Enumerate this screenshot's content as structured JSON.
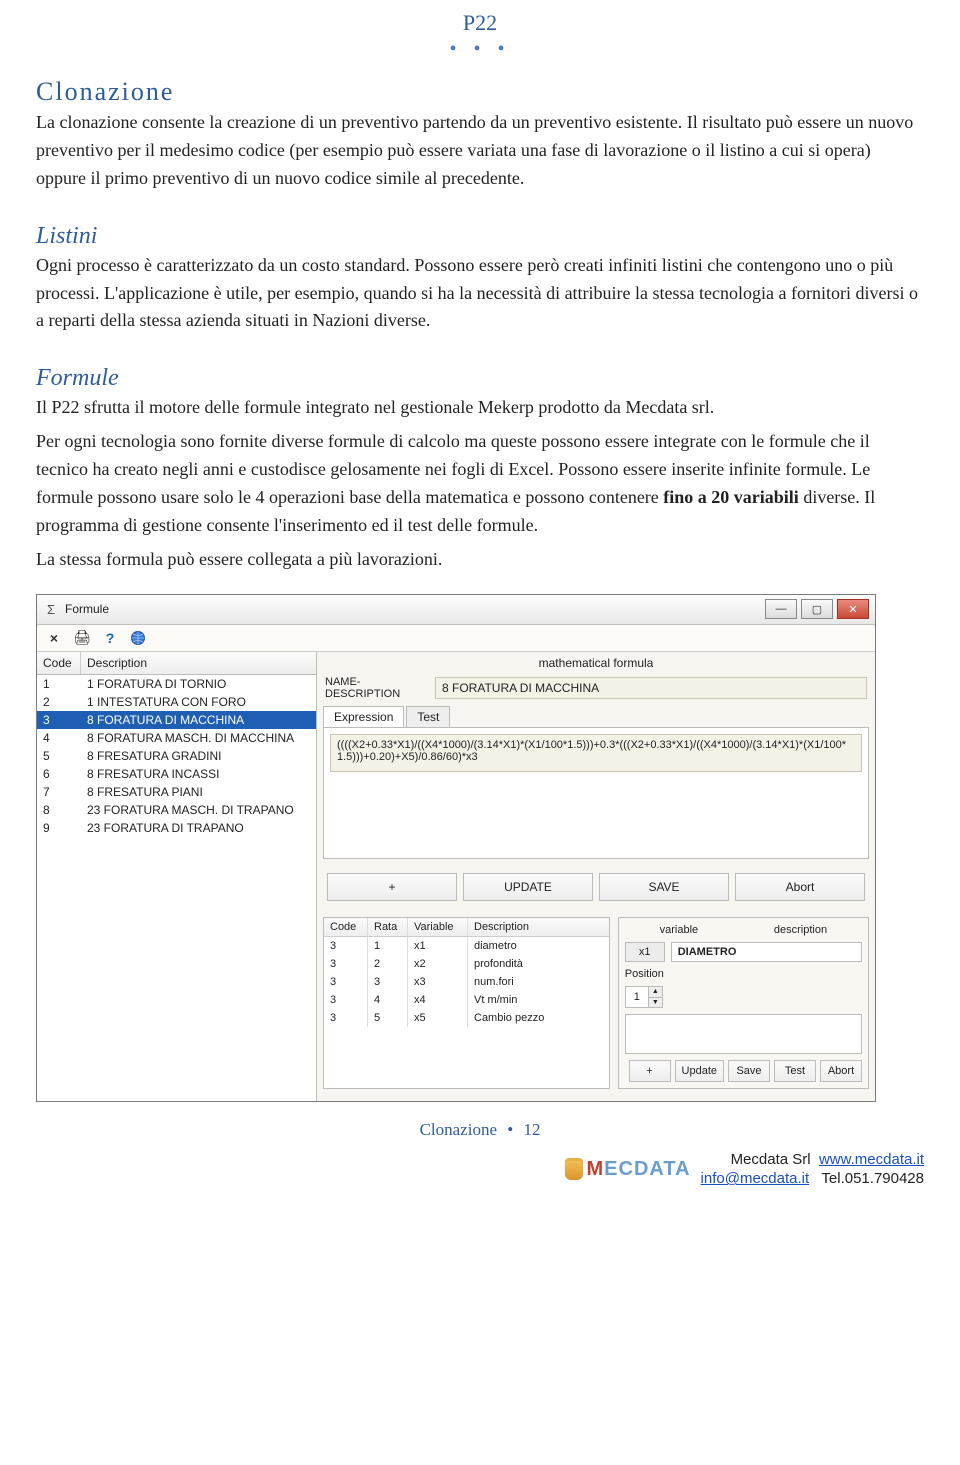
{
  "header": {
    "doc_code": "P22",
    "dots": "• • •"
  },
  "sections": {
    "clonazione": {
      "title": "Clonazione",
      "p1": "La clonazione consente la creazione di un preventivo partendo da un preventivo esistente. Il risultato può essere un nuovo preventivo per il medesimo codice (per esempio può essere variata una fase di lavorazione o il listino a cui si opera) oppure il primo preventivo di un nuovo codice simile al precedente."
    },
    "listini": {
      "title": "Listini",
      "p1": "Ogni processo è caratterizzato da un costo standard. Possono essere però creati infiniti listini che contengono uno o più processi. L'applicazione è utile, per esempio, quando si ha la necessità di attribuire la stessa tecnologia a fornitori diversi o a reparti della stessa azienda situati in Nazioni diverse."
    },
    "formule": {
      "title": "Formule",
      "p1": "Il P22 sfrutta il motore delle formule integrato nel gestionale Mekerp prodotto da  Mecdata srl.",
      "p2a": "Per ogni tecnologia sono fornite diverse formule di calcolo ma queste possono essere integrate con le formule che il tecnico ha creato negli anni e custodisce gelosamente nei fogli di Excel. Possono essere inserite infinite formule. Le formule possono usare solo le 4 operazioni base della matematica e possono contenere ",
      "p2_bold": "fino a 20 variabili",
      "p2b": " diverse. Il programma di gestione consente l'inserimento ed il test delle formule.",
      "p3": "La stessa formula può essere collegata a più lavorazioni."
    }
  },
  "app": {
    "window_title": "Formule",
    "toolbar": {
      "close": "×",
      "print": "🖨",
      "help": "?",
      "web": "🌐"
    },
    "list": {
      "col_code": "Code",
      "col_desc": "Description",
      "rows": [
        {
          "code": "1",
          "desc": "1 FORATURA DI TORNIO"
        },
        {
          "code": "2",
          "desc": "1 INTESTATURA CON FORO"
        },
        {
          "code": "3",
          "desc": "8 FORATURA DI MACCHINA",
          "selected": true
        },
        {
          "code": "4",
          "desc": "8 FORATURA MASCH. DI MACCHINA"
        },
        {
          "code": "5",
          "desc": "8 FRESATURA GRADINI"
        },
        {
          "code": "6",
          "desc": "8 FRESATURA INCASSI"
        },
        {
          "code": "7",
          "desc": "8 FRESATURA PIANI"
        },
        {
          "code": "8",
          "desc": "23 FORATURA MASCH. DI TRAPANO"
        },
        {
          "code": "9",
          "desc": "23 FORATURA DI TRAPANO"
        }
      ]
    },
    "right": {
      "math_label": "mathematical formula",
      "name_label": "NAME-DESCRIPTION",
      "name_value": "8 FORATURA DI MACCHINA",
      "tabs": {
        "expression": "Expression",
        "test": "Test"
      },
      "expression": "((((X2+0.33*X1)/((X4*1000)/(3.14*X1)*(X1/100*1.5)))+0.3*(((X2+0.33*X1)/((X4*1000)/(3.14*X1)*(X1/100*1.5)))+0.20)+X5)/0.86/60)*x3",
      "buttons": {
        "plus": "+",
        "update": "UPDATE",
        "save": "SAVE",
        "abort": "Abort"
      },
      "vars": {
        "head": {
          "code": "Code",
          "rata": "Rata",
          "variable": "Variable",
          "description": "Description"
        },
        "rows": [
          {
            "code": "3",
            "rata": "1",
            "var": "x1",
            "desc": "diametro"
          },
          {
            "code": "3",
            "rata": "2",
            "var": "x2",
            "desc": "profondità"
          },
          {
            "code": "3",
            "rata": "3",
            "var": "x3",
            "desc": "num.fori"
          },
          {
            "code": "3",
            "rata": "4",
            "var": "x4",
            "desc": "Vt m/min"
          },
          {
            "code": "3",
            "rata": "5",
            "var": "x5",
            "desc": "Cambio pezzo"
          }
        ]
      },
      "detail": {
        "lbl_variable": "variable",
        "lbl_description": "description",
        "var_value": "x1",
        "desc_value": "DIAMETRO",
        "lbl_position": "Position",
        "position_value": "1",
        "btns": {
          "plus": "+",
          "update": "Update",
          "save": "Save",
          "test": "Test",
          "abort": "Abort"
        }
      }
    }
  },
  "page_footer": {
    "text": "Clonazione",
    "dot": "•",
    "num": "12"
  },
  "brand": {
    "company": "Mecdata Srl",
    "web_label": "www.mecdata.it",
    "email": "info@mecdata.it",
    "tel": "Tel.051.790428"
  }
}
